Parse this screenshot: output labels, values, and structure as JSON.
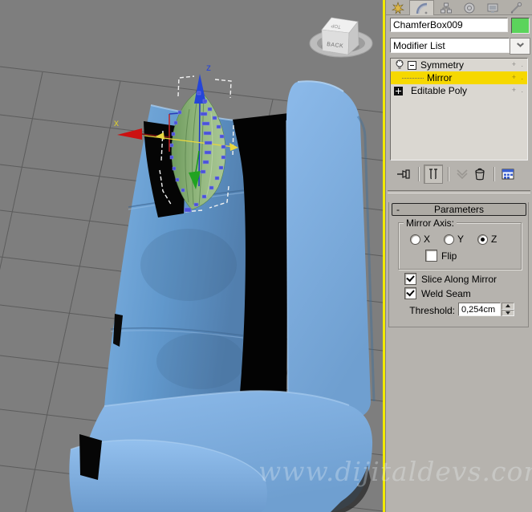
{
  "viewport": {
    "axis_labels": {
      "x": "x",
      "z": "z"
    },
    "viewcube": {
      "front_face": "BACK",
      "top_face": "TOP"
    },
    "watermark": "www.dijitaldevs.com",
    "colors": {
      "background": "#7e7e7e",
      "grid_line": "#5c5c5c",
      "active_border": "#f2ea00",
      "couch_blue": "#6ea3d6",
      "gizmo_green": "#8fb47a",
      "axis_x_red": "#cc1111",
      "axis_z_blue": "#2545d8",
      "axis_y_green": "#22aa22"
    }
  },
  "panel": {
    "command_tabs": {
      "tabs": [
        "create",
        "modify",
        "hierarchy",
        "motion",
        "display",
        "utilities"
      ],
      "active": "modify"
    },
    "object_name": {
      "value": "ChamferBox009"
    },
    "color_swatch": {
      "color": "#5bd45b"
    },
    "modifier_dropdown": {
      "value": "Modifier List"
    },
    "modifier_stack": {
      "rows": [
        {
          "label": "Symmetry",
          "selected": false
        },
        {
          "label": "Mirror",
          "selected": true
        },
        {
          "label": "Editable Poly",
          "selected": false
        }
      ],
      "selection_color": "#f6d800",
      "edge_marks": "+ ."
    },
    "stack_toolbar": {
      "buttons": [
        "pin-stack",
        "show-end-result",
        "make-unique",
        "remove-modifier",
        "configure-modifier-sets"
      ],
      "active": "show-end-result"
    },
    "parameters_rollout": {
      "collapse_glyph": "-",
      "title": "Parameters",
      "mirror_axis_group": {
        "label": "Mirror Axis:",
        "options": [
          {
            "label": "X",
            "selected": false
          },
          {
            "label": "Y",
            "selected": false
          },
          {
            "label": "Z",
            "selected": true
          }
        ],
        "flip": {
          "label": "Flip",
          "checked": false
        }
      },
      "slice_along_mirror": {
        "label": "Slice Along Mirror",
        "checked": true
      },
      "weld_seam": {
        "label": "Weld Seam",
        "checked": true
      },
      "threshold": {
        "label": "Threshold:",
        "value": "0,254cm"
      }
    }
  }
}
